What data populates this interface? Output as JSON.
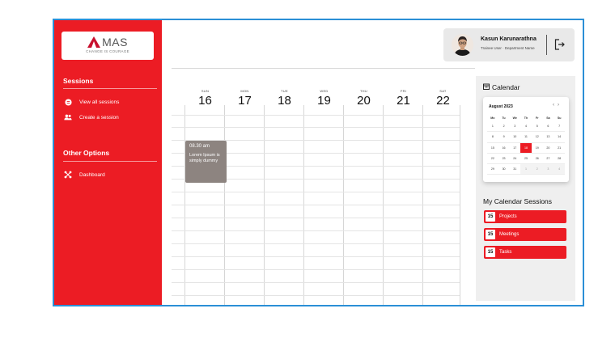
{
  "logo": {
    "name": "MAS",
    "tagline": "CHANGE IS COURAGE"
  },
  "sidebar": {
    "sessions_title": "Sessions",
    "sessions_items": [
      {
        "label": "View all sessions",
        "icon": "view-sessions-icon"
      },
      {
        "label": "Create a session",
        "icon": "users-icon"
      }
    ],
    "other_title": "Other Options",
    "other_items": [
      {
        "label": "Dashboard",
        "icon": "dashboard-icon"
      }
    ]
  },
  "profile": {
    "name": "Kasun Karunarathna",
    "role": "Trainee User · Department Name"
  },
  "week": {
    "days": [
      {
        "name": "SUN",
        "num": "16"
      },
      {
        "name": "MON",
        "num": "17"
      },
      {
        "name": "TUE",
        "num": "18"
      },
      {
        "name": "WED",
        "num": "19"
      },
      {
        "name": "THU",
        "num": "20"
      },
      {
        "name": "FRI",
        "num": "21"
      },
      {
        "name": "SAT",
        "num": "22"
      }
    ]
  },
  "event": {
    "time": "08.30 am",
    "desc": "Lorem Ipsum is simply dummy"
  },
  "calendar": {
    "title": "Calendar",
    "month": "August 2023",
    "weekdays": [
      "Mo",
      "Tu",
      "We",
      "Th",
      "Fr",
      "Sa",
      "Su"
    ],
    "selected": "18",
    "rows": [
      [
        "1",
        "2",
        "3",
        "4",
        "5",
        "6",
        "7"
      ],
      [
        "8",
        "9",
        "10",
        "11",
        "12",
        "13",
        "14"
      ],
      [
        "15",
        "16",
        "17",
        "18",
        "19",
        "20",
        "21"
      ],
      [
        "22",
        "23",
        "24",
        "25",
        "26",
        "27",
        "28"
      ],
      [
        "29",
        "30",
        "31",
        "1",
        "2",
        "3",
        "4"
      ]
    ]
  },
  "my_sessions": {
    "title": "My Calendar Sessions",
    "items": [
      {
        "count": "15",
        "label": "Projects"
      },
      {
        "count": "15",
        "label": "Meetings"
      },
      {
        "count": "15",
        "label": "Tasks"
      }
    ]
  },
  "colors": {
    "accent": "#ec1c24",
    "frame": "#2b8fd6",
    "event": "#8d8480"
  }
}
